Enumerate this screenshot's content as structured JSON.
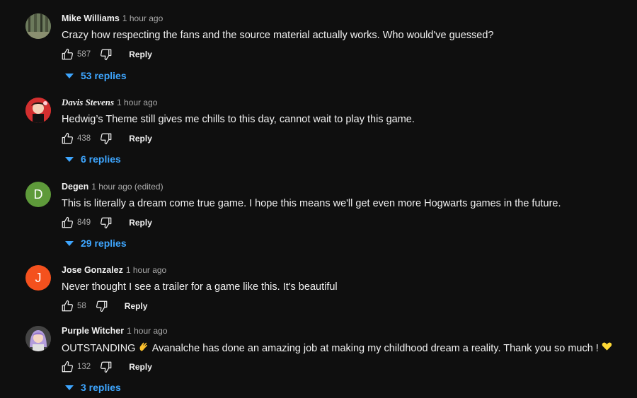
{
  "comments": [
    {
      "author": "Mike Williams",
      "time": "1 hour ago",
      "text": "Crazy how respecting the fans and the source material actually works. Who would've guessed?",
      "likes": "587",
      "reply_label": "Reply",
      "replies_label": "53 replies",
      "avatar": "forest-photo-avatar"
    },
    {
      "author": "Davis Stevens",
      "time": "1 hour ago",
      "text": "Hedwig’s Theme still gives me chills to this day, cannot wait to play this game.",
      "likes": "438",
      "reply_label": "Reply",
      "replies_label": "6 replies",
      "avatar": "red-anime-avatar"
    },
    {
      "author": "Degen",
      "time": "1 hour ago (edited)",
      "text": "This is literally a dream come true game. I hope this means we'll get even more Hogwarts games in the future.",
      "likes": "849",
      "reply_label": "Reply",
      "replies_label": "29 replies",
      "avatar_letter": "D",
      "avatar_color": "#5e9a3a"
    },
    {
      "author": "Jose Gonzalez",
      "time": "1 hour ago",
      "text": "Never thought I see a trailer for a game like this.  It's beautiful",
      "likes": "58",
      "reply_label": "Reply",
      "avatar_letter": "J",
      "avatar_color": "#f4511e"
    },
    {
      "author": "Purple Witcher",
      "time": "1 hour ago",
      "text_a": "OUTSTANDING",
      "text_b": "Avanalche has done an amazing job at making my childhood dream a reality. Thank you so much !",
      "likes": "132",
      "reply_label": "Reply",
      "replies_label": "3 replies",
      "avatar": "purple-hair-avatar"
    }
  ],
  "colors": {
    "background": "#0f0f0f",
    "link": "#3ea6ff",
    "muted": "#aaaaaa"
  }
}
